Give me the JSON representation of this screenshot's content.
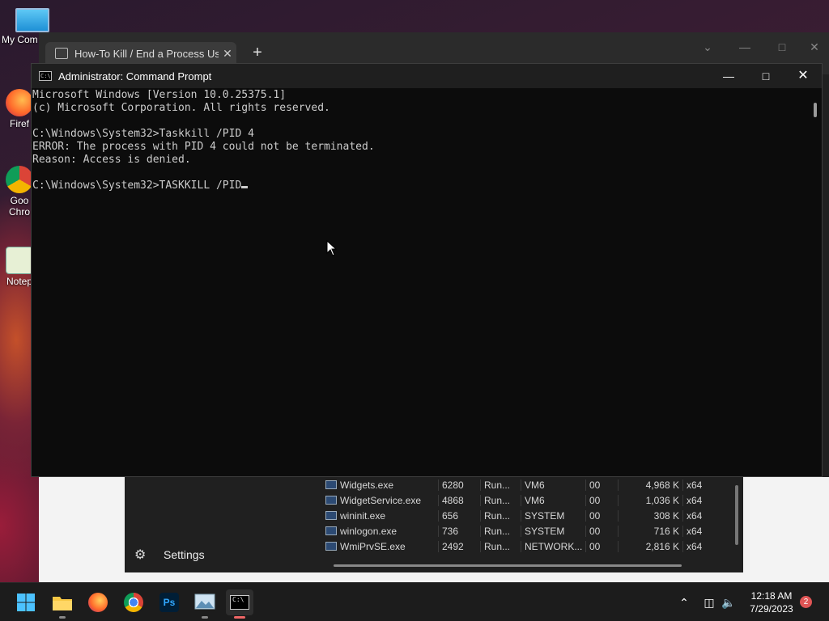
{
  "desktop": {
    "icons": [
      {
        "label": "My Com",
        "icon": "monitor-icon"
      },
      {
        "label": "Firef",
        "icon": "firefox-icon"
      },
      {
        "label": "Goo\nChro",
        "icon": "chrome-icon"
      },
      {
        "label": "Notep",
        "icon": "notepad-icon"
      }
    ]
  },
  "browser": {
    "tab_title": "How-To Kill / End a Process Usin",
    "close_glyph": "✕",
    "new_tab_glyph": "+"
  },
  "cmd": {
    "title": "Administrator: Command Prompt",
    "lines": [
      "Microsoft Windows [Version 10.0.25375.1]",
      "(c) Microsoft Corporation. All rights reserved.",
      "",
      "C:\\Windows\\System32>Taskkill /PID 4",
      "ERROR: The process with PID 4 could not be terminated.",
      "Reason: Access is denied.",
      "",
      "C:\\Windows\\System32>TASKKILL /PID"
    ]
  },
  "taskmgr": {
    "settings_label": "Settings",
    "rows": [
      {
        "name": "Widgets.exe",
        "pid": "6280",
        "status": "Run...",
        "user": "VM6",
        "cpu": "00",
        "mem": "4,968 K",
        "arch": "x64"
      },
      {
        "name": "WidgetService.exe",
        "pid": "4868",
        "status": "Run...",
        "user": "VM6",
        "cpu": "00",
        "mem": "1,036 K",
        "arch": "x64"
      },
      {
        "name": "wininit.exe",
        "pid": "656",
        "status": "Run...",
        "user": "SYSTEM",
        "cpu": "00",
        "mem": "308 K",
        "arch": "x64"
      },
      {
        "name": "winlogon.exe",
        "pid": "736",
        "status": "Run...",
        "user": "SYSTEM",
        "cpu": "00",
        "mem": "716 K",
        "arch": "x64"
      },
      {
        "name": "WmiPrvSE.exe",
        "pid": "2492",
        "status": "Run...",
        "user": "NETWORK...",
        "cpu": "00",
        "mem": "2,816 K",
        "arch": "x64"
      }
    ]
  },
  "taskbar": {
    "apps": [
      "start-icon",
      "file-explorer-icon",
      "firefox-icon",
      "chrome-icon",
      "photoshop-icon",
      "photos-icon",
      "terminal-icon"
    ],
    "photoshop_label": "Ps",
    "time": "12:18 AM",
    "date": "7/29/2023",
    "notification_count": "2"
  },
  "colors": {
    "console_bg": "#0c0c0c",
    "console_text": "#cccccc",
    "accent": "#0078d4",
    "badge": "#e05555"
  }
}
